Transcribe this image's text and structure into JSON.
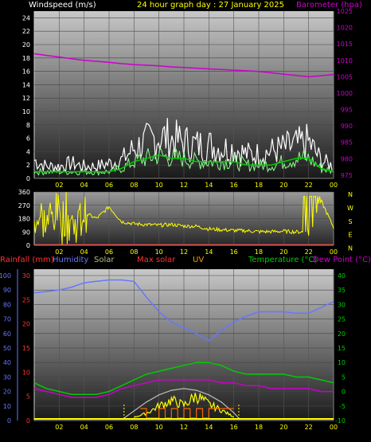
{
  "header": {
    "wind_title": "Windspeed (m/s)",
    "date_title": "24 hour graph day : 27 January 2025",
    "baro_title": "Barometer (hpa)"
  },
  "legend": {
    "rain": "Rainfall (mm)",
    "humidity": "Humidity",
    "solar": "Solar",
    "maxsolar": "Max solar",
    "uv": "UV",
    "temp": "Temperature (°C)",
    "dew": "Dew Point (°C)"
  },
  "colors": {
    "wind_gust": "#ffffff",
    "wind_avg": "#00cc00",
    "barometer": "#cc00cc",
    "direction": "#ffff00",
    "rain": "#ff3333",
    "humidity": "#6677ff",
    "solar": "#ffff00",
    "maxsolar": "#bbbbbb",
    "uv": "#ff6600",
    "temperature": "#00cc00",
    "dewpoint": "#cc00cc",
    "axis_label": "#ffff00"
  },
  "chart_data": [
    {
      "type": "line",
      "title": "Windspeed (m/s) / Barometer (hpa)",
      "x_ticks": [
        "02",
        "04",
        "06",
        "08",
        "10",
        "12",
        "14",
        "16",
        "18",
        "20",
        "22",
        "00"
      ],
      "y_left": {
        "label": "Windspeed (m/s)",
        "ticks": [
          0,
          2,
          4,
          6,
          8,
          10,
          12,
          14,
          16,
          18,
          20,
          22,
          24
        ],
        "range": [
          0,
          25
        ]
      },
      "y_right": {
        "label": "Barometer (hpa)",
        "ticks": [
          975,
          980,
          985,
          990,
          995,
          1000,
          1005,
          1010,
          1015,
          1020,
          1025
        ],
        "range": [
          974,
          1025
        ]
      },
      "series": [
        {
          "name": "Barometer",
          "axis": "right",
          "x": [
            0,
            1,
            2,
            3,
            4,
            5,
            6,
            7,
            8,
            9,
            10,
            11,
            12,
            13,
            14,
            15,
            16,
            17,
            18,
            19,
            20,
            21,
            22,
            23,
            24
          ],
          "values": [
            1012,
            1011.5,
            1011,
            1010.5,
            1010,
            1009.7,
            1009.4,
            1009,
            1008.7,
            1008.5,
            1008.3,
            1008,
            1007.8,
            1007.6,
            1007.4,
            1007.2,
            1007,
            1006.8,
            1006.6,
            1006.2,
            1005.8,
            1005.4,
            1005,
            1005.3,
            1005.7
          ]
        },
        {
          "name": "Gust",
          "axis": "left",
          "x": [
            0,
            1,
            2,
            3,
            4,
            5,
            6,
            7,
            8,
            9,
            10,
            11,
            12,
            13,
            14,
            15,
            16,
            17,
            18,
            19,
            20,
            21,
            22,
            23,
            24
          ],
          "values": [
            3,
            2,
            2,
            2.5,
            2,
            2,
            2.5,
            3,
            5,
            6,
            7,
            6.5,
            6,
            5.5,
            5.5,
            5,
            5,
            4,
            4,
            4.5,
            5,
            5.5,
            6,
            3,
            2
          ]
        },
        {
          "name": "Average",
          "axis": "left",
          "x": [
            0,
            1,
            2,
            3,
            4,
            5,
            6,
            7,
            8,
            9,
            10,
            11,
            12,
            13,
            14,
            15,
            16,
            17,
            18,
            19,
            20,
            21,
            22,
            23,
            24
          ],
          "values": [
            1,
            1,
            1,
            1,
            1,
            1,
            1,
            1.5,
            2.5,
            3,
            3.5,
            3,
            3,
            2.5,
            2.5,
            2.5,
            2.5,
            2,
            2,
            2,
            2.5,
            3,
            3,
            1.5,
            1
          ]
        }
      ]
    },
    {
      "type": "scatter",
      "title": "Wind direction",
      "x_ticks": [
        "02",
        "04",
        "06",
        "08",
        "10",
        "12",
        "14",
        "16",
        "18",
        "20",
        "22",
        "00"
      ],
      "y": {
        "ticks": [
          0,
          90,
          180,
          270,
          360
        ],
        "range": [
          0,
          360
        ]
      },
      "compass_labels": [
        "N",
        "W",
        "S",
        "E",
        "N"
      ],
      "series": [
        {
          "name": "Direction",
          "x": [
            0,
            1,
            2,
            3,
            4,
            5,
            6,
            7,
            8,
            9,
            10,
            11,
            12,
            13,
            14,
            15,
            16,
            17,
            18,
            19,
            20,
            21,
            22,
            23,
            24
          ],
          "values": [
            200,
            150,
            250,
            100,
            220,
            180,
            260,
            160,
            145,
            140,
            135,
            140,
            130,
            128,
            110,
            105,
            100,
            98,
            92,
            92,
            95,
            90,
            92,
            300,
            120
          ]
        }
      ]
    },
    {
      "type": "line",
      "title": "Temperature / Humidity / Solar",
      "x_ticks": [
        "02",
        "04",
        "06",
        "08",
        "10",
        "12",
        "14",
        "16",
        "18",
        "20",
        "22",
        "00"
      ],
      "y_left_outer": {
        "label": "Humidity",
        "ticks": [
          0,
          10,
          20,
          30,
          40,
          50,
          60,
          70,
          80,
          90,
          100
        ],
        "range": [
          0,
          100
        ]
      },
      "y_left_inner": {
        "label": "Rainfall (mm)",
        "ticks": [
          0,
          5,
          10,
          15,
          20,
          25,
          30
        ],
        "range": [
          0,
          30
        ]
      },
      "y_right": {
        "label": "Temperature (°C)",
        "ticks": [
          -10,
          -5,
          0,
          5,
          10,
          15,
          20,
          25,
          30,
          35,
          40
        ],
        "range": [
          -10,
          40
        ]
      },
      "series": [
        {
          "name": "Humidity",
          "axis": "left",
          "x": [
            0,
            1,
            2,
            3,
            4,
            5,
            6,
            7,
            8,
            9,
            10,
            11,
            12,
            13,
            14,
            15,
            16,
            17,
            18,
            19,
            20,
            21,
            22,
            23,
            24
          ],
          "values": [
            88,
            89,
            90,
            92,
            95,
            96,
            97,
            97,
            96,
            85,
            75,
            68,
            64,
            60,
            55,
            62,
            68,
            72,
            75,
            75,
            75,
            74,
            74,
            78,
            82
          ]
        },
        {
          "name": "Temperature",
          "axis": "right",
          "x": [
            0,
            1,
            2,
            3,
            4,
            5,
            6,
            7,
            8,
            9,
            10,
            11,
            12,
            13,
            14,
            15,
            16,
            17,
            18,
            19,
            20,
            21,
            22,
            23,
            24
          ],
          "values": [
            3,
            1,
            0,
            -1,
            -1,
            -1,
            0,
            2,
            4,
            6,
            7,
            8,
            9,
            10,
            10,
            9,
            7,
            6,
            6,
            6,
            6,
            5,
            5,
            4,
            3
          ]
        },
        {
          "name": "Dew Point",
          "axis": "right",
          "x": [
            0,
            1,
            2,
            3,
            4,
            5,
            6,
            7,
            8,
            9,
            10,
            11,
            12,
            13,
            14,
            15,
            16,
            17,
            18,
            19,
            20,
            21,
            22,
            23,
            24
          ],
          "values": [
            1,
            0,
            -1,
            -2,
            -2,
            -2,
            -1,
            1,
            2,
            3,
            4,
            4,
            4,
            4,
            4,
            3,
            3,
            2,
            2,
            1,
            1,
            1,
            1,
            0,
            0
          ]
        },
        {
          "name": "Max solar",
          "axis": "solar",
          "x": [
            7.2,
            8,
            9,
            10,
            11,
            12,
            13,
            14,
            15,
            16,
            16.4
          ],
          "values": [
            0,
            80,
            180,
            260,
            310,
            330,
            310,
            260,
            180,
            60,
            0
          ]
        },
        {
          "name": "Solar",
          "axis": "solar",
          "x": [
            8,
            9,
            10,
            11,
            12,
            13,
            14,
            15,
            16
          ],
          "values": [
            10,
            60,
            150,
            220,
            160,
            280,
            170,
            100,
            15
          ]
        }
      ]
    }
  ]
}
